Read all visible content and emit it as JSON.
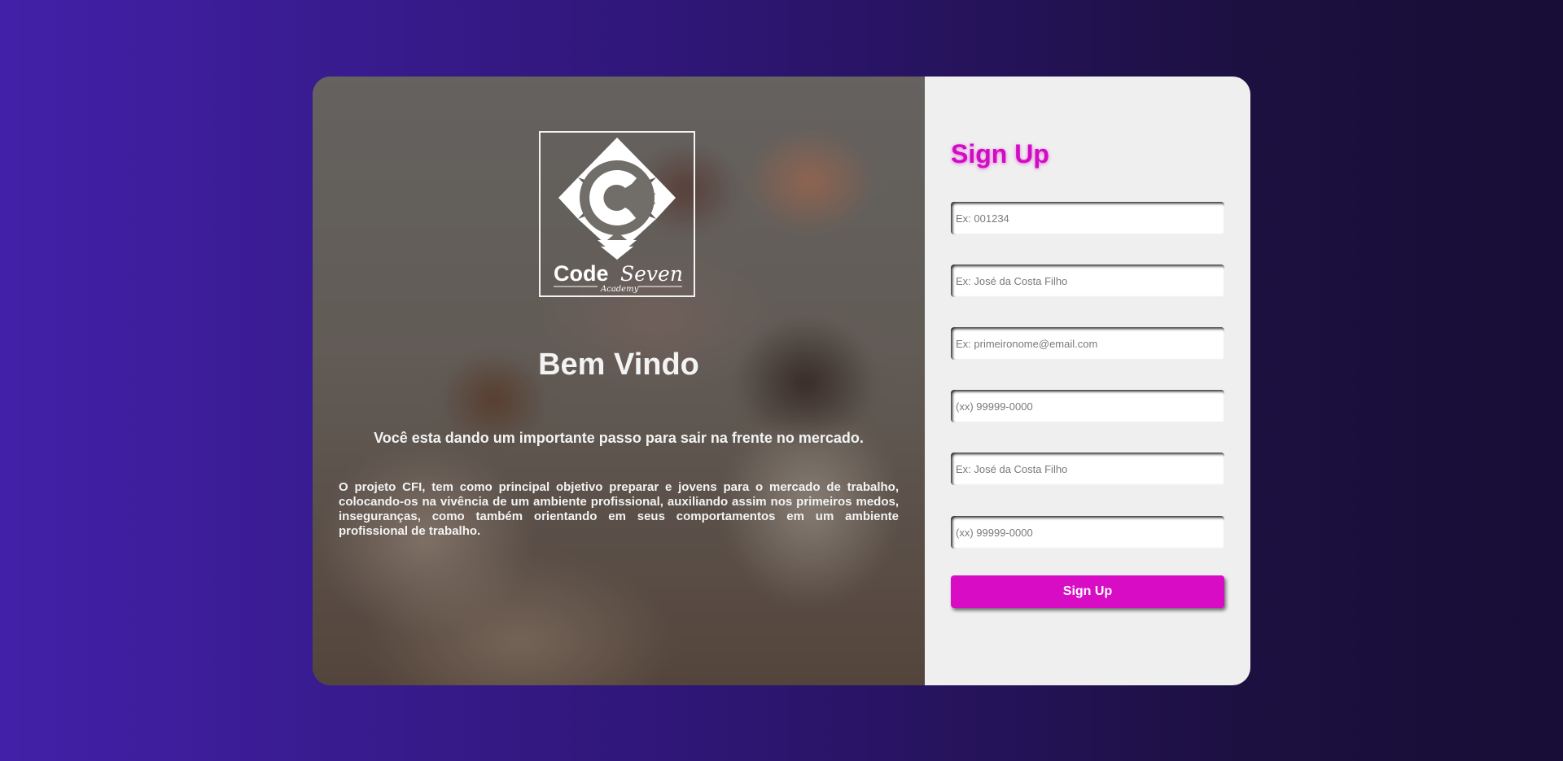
{
  "brand": {
    "logo_icon": "code-seven-diamond-c-logo",
    "logo_text_main": "Code",
    "logo_text_script": "Seven",
    "logo_text_sub": "Academy"
  },
  "welcome": {
    "title": "Bem Vindo",
    "tagline": "Você esta dando um importante passo para sair na frente no mercado.",
    "description": "O projeto CFI, tem como principal objetivo preparar e jovens para o mercado de trabalho, colocando-os na vivência de um ambiente profissional, auxiliando assim nos primeiros medos, inseguranças, como também orientando em seus comportamentos em um ambiente profissional de trabalho."
  },
  "signup": {
    "title": "Sign Up",
    "fields": [
      {
        "placeholder": "Ex: 001234",
        "value": ""
      },
      {
        "placeholder": "Ex: José da Costa Filho",
        "value": ""
      },
      {
        "placeholder": "Ex: primeironome@email.com",
        "value": ""
      },
      {
        "placeholder": "(xx) 99999-0000",
        "value": ""
      },
      {
        "placeholder": "Ex: José da Costa Filho",
        "value": ""
      },
      {
        "placeholder": "(xx) 99999-0000",
        "value": ""
      }
    ],
    "button_label": "Sign Up"
  },
  "colors": {
    "accent": "#d90cc6",
    "background_start": "#4320a8",
    "background_end": "#170d36",
    "panel": "#efefef"
  }
}
